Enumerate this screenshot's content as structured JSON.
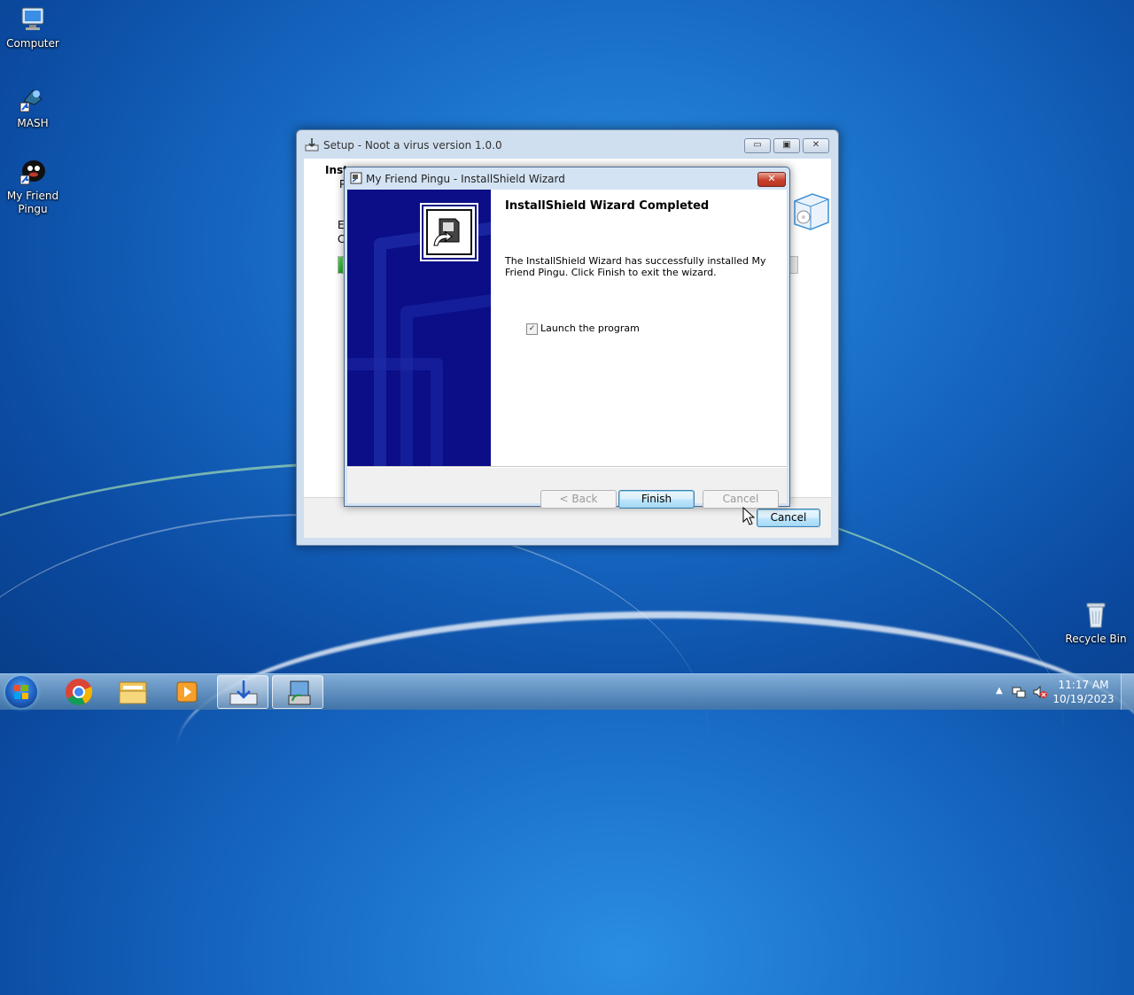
{
  "desktop": {
    "icons": [
      {
        "label": "Computer"
      },
      {
        "label": "MASH"
      },
      {
        "label": "My Friend Pingu"
      },
      {
        "label": "Recycle Bin"
      }
    ]
  },
  "setup_window": {
    "title": "Setup - Noot a virus version 1.0.0",
    "heading": "Insta",
    "subheading": "P",
    "line1": "E",
    "line2": "C",
    "progress": 0.01,
    "cancel_label": "Cancel"
  },
  "wizard": {
    "title": "My Friend Pingu - InstallShield Wizard",
    "heading": "InstallShield Wizard Completed",
    "message": "The InstallShield Wizard has successfully installed My Friend Pingu. Click Finish to exit the wizard.",
    "checkbox_label": "Launch the program",
    "checkbox_checked": true,
    "back_label": "< Back",
    "finish_label": "Finish",
    "cancel_label": "Cancel"
  },
  "taskbar": {
    "items": [
      "start",
      "chrome",
      "file-explorer",
      "media-player",
      "setup",
      "installshield"
    ],
    "time": "11:17 AM",
    "date": "10/19/2023"
  }
}
